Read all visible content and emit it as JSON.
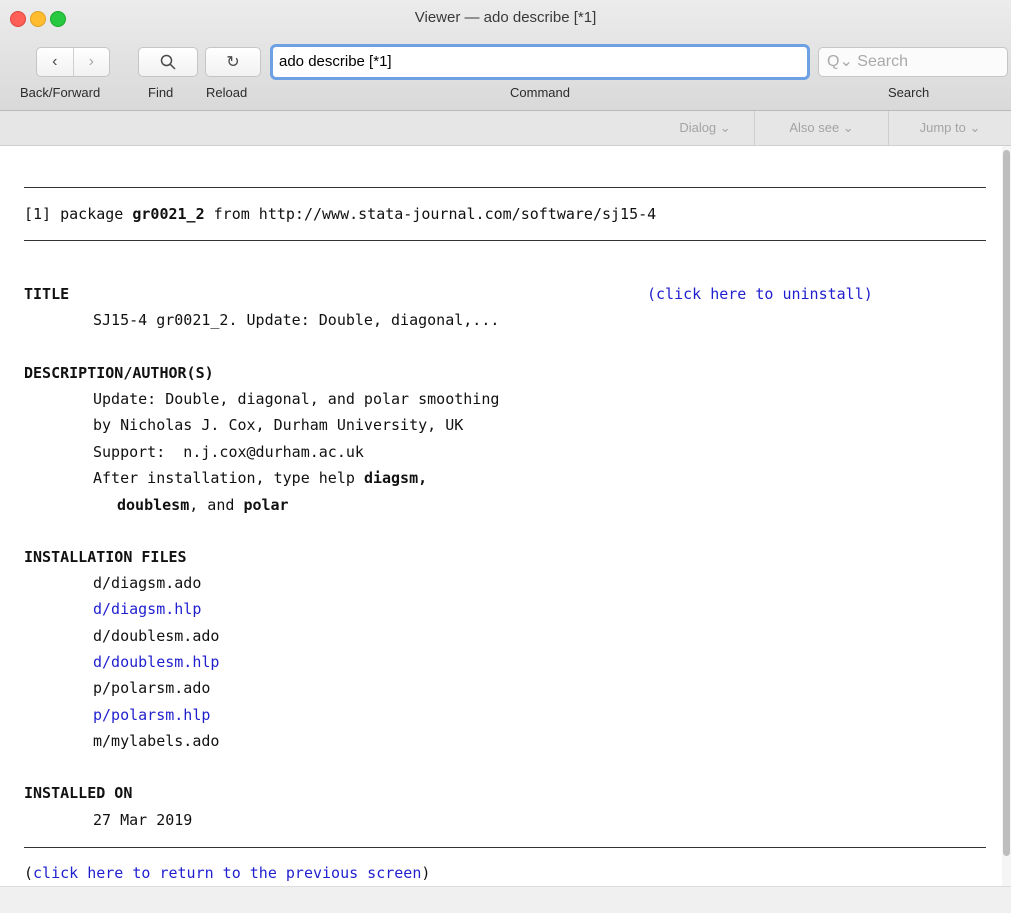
{
  "window": {
    "title": "Viewer — ado describe [*1]"
  },
  "toolbar": {
    "back_forward_label": "Back/Forward",
    "find_label": "Find",
    "reload_label": "Reload",
    "command_label": "Command",
    "search_label": "Search",
    "command_value": "ado describe [*1]",
    "search_placeholder": "Q⌄ Search"
  },
  "menus": {
    "dialog": "Dialog ⌄",
    "also_see": "Also see ⌄",
    "jump_to": "Jump to ⌄"
  },
  "content": {
    "pkg_prefix": "[1] package ",
    "pkg_name": "gr0021_2",
    "pkg_from": " from http://www.stata-journal.com/software/sj15-4",
    "title_heading": "TITLE",
    "uninstall_link": "(click here to uninstall)",
    "title_text": "SJ15-4 gr0021_2. Update: Double, diagonal,...",
    "desc_heading": "DESCRIPTION/AUTHOR(S)",
    "desc_line1": "Update: Double, diagonal, and polar smoothing",
    "desc_line2": "by Nicholas J. Cox, Durham University, UK",
    "desc_line3": "Support:  n.j.cox@durham.ac.uk",
    "desc_line4_pre": "After installation, type help ",
    "desc_line4_bold": "diagsm,",
    "desc_line5_b1": "doublesm",
    "desc_line5_mid": ", and ",
    "desc_line5_b2": "polar",
    "files_heading": "INSTALLATION FILES",
    "files": [
      {
        "name": "d/diagsm.ado",
        "link": false
      },
      {
        "name": "d/diagsm.hlp",
        "link": true
      },
      {
        "name": "d/doublesm.ado",
        "link": false
      },
      {
        "name": "d/doublesm.hlp",
        "link": true
      },
      {
        "name": "p/polarsm.ado",
        "link": false
      },
      {
        "name": "p/polarsm.hlp",
        "link": true
      },
      {
        "name": "m/mylabels.ado",
        "link": false
      }
    ],
    "installed_heading": "INSTALLED ON",
    "installed_date": "27 Mar 2019",
    "return_open": "(",
    "return_link": "click here to return to the previous screen",
    "return_close": ")"
  },
  "colors": {
    "link": "#1f1fcf",
    "focus_ring": "#6ea0e4"
  }
}
